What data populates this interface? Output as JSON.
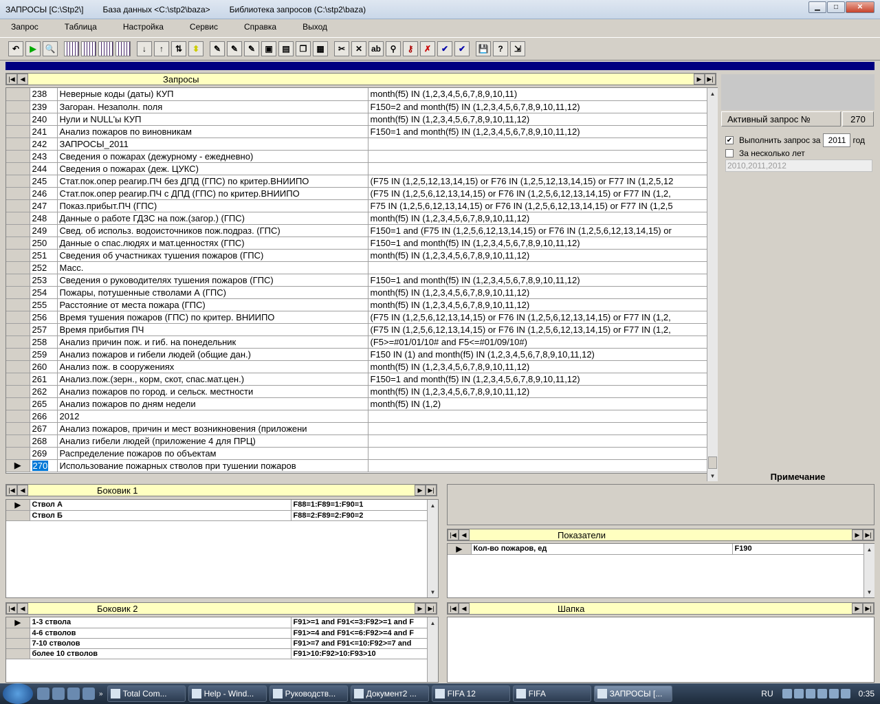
{
  "window": {
    "title": "ЗАПРОСЫ [C:\\Stp2\\]",
    "db": "База данных <C:\\stp2\\baza>",
    "lib": "Библиотека запросов (C:\\stp2\\baza)"
  },
  "menu": [
    "Запрос",
    "Таблица",
    "Настройка",
    "Сервис",
    "Справка",
    "Выход"
  ],
  "main": {
    "title": "Запросы",
    "rows": [
      {
        "n": "238",
        "name": "Неверные коды (даты) КУП",
        "cond": "month(f5) IN (1,2,3,4,5,6,7,8,9,10,11)"
      },
      {
        "n": "239",
        "name": "Загоран. Незаполн. поля",
        "cond": "F150=2 and month(f5) IN (1,2,3,4,5,6,7,8,9,10,11,12)"
      },
      {
        "n": "240",
        "name": "Нули и NULL'ы КУП",
        "cond": "month(f5) IN (1,2,3,4,5,6,7,8,9,10,11,12)"
      },
      {
        "n": "241",
        "name": "Анализ пожаров по виновникам",
        "cond": "F150=1 and month(f5) IN (1,2,3,4,5,6,7,8,9,10,11,12)"
      },
      {
        "n": "242",
        "name": "ЗАПРОСЫ_2011",
        "cond": ""
      },
      {
        "n": "243",
        "name": "Сведения о пожарах (дежурному - ежедневно)",
        "cond": ""
      },
      {
        "n": "244",
        "name": "Сведения о пожарах (деж. ЦУКС)",
        "cond": ""
      },
      {
        "n": "245",
        "name": "Стат.пок.опер реагир.ПЧ без ДПД (ГПС) по критер.ВНИИПО",
        "cond": "(F75 IN (1,2,5,12,13,14,15) or F76 IN (1,2,5,12,13,14,15) or F77 IN (1,2,5,12"
      },
      {
        "n": "246",
        "name": "Стат.пок.опер реагир.ПЧ с ДПД (ГПС) по критер.ВНИИПО",
        "cond": "(F75 IN (1,2,5,6,12,13,14,15) or F76 IN (1,2,5,6,12,13,14,15) or F77 IN (1,2,"
      },
      {
        "n": "247",
        "name": "Показ.прибыт.ПЧ (ГПС)",
        "cond": "F75 IN (1,2,5,6,12,13,14,15) or F76 IN (1,2,5,6,12,13,14,15) or F77 IN (1,2,5"
      },
      {
        "n": "248",
        "name": "Данные о работе ГДЗС на пож.(загор.) (ГПС)",
        "cond": "month(f5) IN (1,2,3,4,5,6,7,8,9,10,11,12)"
      },
      {
        "n": "249",
        "name": "Свед. об использ. водоисточников пож.подраз. (ГПС)",
        "cond": "F150=1 and (F75 IN (1,2,5,6,12,13,14,15) or F76 IN (1,2,5,6,12,13,14,15) or"
      },
      {
        "n": "250",
        "name": "Данные о спас.людях и мат.ценностях (ГПС)",
        "cond": "F150=1 and month(f5) IN (1,2,3,4,5,6,7,8,9,10,11,12)"
      },
      {
        "n": "251",
        "name": "Сведения об участниках тушения пожаров (ГПС)",
        "cond": "month(f5) IN (1,2,3,4,5,6,7,8,9,10,11,12)"
      },
      {
        "n": "252",
        "name": "Масс.",
        "cond": ""
      },
      {
        "n": "253",
        "name": "Сведения о руководителях тушения пожаров (ГПС)",
        "cond": "F150=1 and month(f5) IN (1,2,3,4,5,6,7,8,9,10,11,12)"
      },
      {
        "n": "254",
        "name": "Пожары, потушенные стволами А (ГПС)",
        "cond": "month(f5) IN (1,2,3,4,5,6,7,8,9,10,11,12)"
      },
      {
        "n": "255",
        "name": "Расстояние от места пожара (ГПС)",
        "cond": "month(f5) IN (1,2,3,4,5,6,7,8,9,10,11,12)"
      },
      {
        "n": "256",
        "name": "Время тушения пожаров (ГПС) по критер. ВНИИПО",
        "cond": "(F75 IN (1,2,5,6,12,13,14,15) or F76 IN (1,2,5,6,12,13,14,15) or F77 IN (1,2,"
      },
      {
        "n": "257",
        "name": "Время прибытия ПЧ",
        "cond": "(F75 IN (1,2,5,6,12,13,14,15) or F76 IN (1,2,5,6,12,13,14,15) or F77 IN (1,2,"
      },
      {
        "n": "258",
        "name": "Анализ причин пож. и гиб. на понедельник",
        "cond": "(F5>=#01/01/10# and F5<=#01/09/10#)"
      },
      {
        "n": "259",
        "name": "Анализ пожаров и гибели людей (общие дан.)",
        "cond": "F150 IN (1) and month(f5) IN (1,2,3,4,5,6,7,8,9,10,11,12)"
      },
      {
        "n": "260",
        "name": "Анализ пож. в сооружениях",
        "cond": "month(f5) IN (1,2,3,4,5,6,7,8,9,10,11,12)"
      },
      {
        "n": "261",
        "name": "Анализ.пож.(зерн., корм, скот, спас.мат.цен.)",
        "cond": "F150=1 and month(f5) IN (1,2,3,4,5,6,7,8,9,10,11,12)"
      },
      {
        "n": "262",
        "name": "Анализ пожаров по город. и сельск. местности",
        "cond": "month(f5) IN (1,2,3,4,5,6,7,8,9,10,11,12)"
      },
      {
        "n": "265",
        "name": "Анализ пожаров по дням недели",
        "cond": "month(f5) IN (1,2)"
      },
      {
        "n": "266",
        "name": "2012",
        "cond": ""
      },
      {
        "n": "267",
        "name": "Анализ пожаров, причин и мест возникновения (приложени",
        "cond": ""
      },
      {
        "n": "268",
        "name": "Анализ гибели людей (приложение 4 для ПРЦ)",
        "cond": ""
      },
      {
        "n": "269",
        "name": "Распределение пожаров по объектам",
        "cond": ""
      },
      {
        "n": "270",
        "name": "Использование пожарных стволов при тушении пожаров",
        "cond": "",
        "selected": true
      }
    ]
  },
  "right": {
    "active_label": "Активный запрос №",
    "active_value": "270",
    "run_label": "Выполнить запрос за",
    "run_year": "2011",
    "year_suffix": "год",
    "multi_label": "За несколько лет",
    "multi_value": "2010,2011,2012",
    "note_label": "Примечание"
  },
  "side1": {
    "title": "Боковик 1",
    "rows": [
      {
        "name": "Ствол А",
        "cond": "F88=1:F89=1:F90=1"
      },
      {
        "name": "Ствол Б",
        "cond": "F88=2:F89=2:F90=2"
      }
    ]
  },
  "indicators": {
    "title": "Показатели",
    "rows": [
      {
        "name": "Кол-во пожаров, ед",
        "cond": "F190"
      }
    ]
  },
  "side2": {
    "title": "Боковик 2",
    "rows": [
      {
        "name": "1-3 ствола",
        "cond": "F91>=1 and F91<=3:F92>=1 and F"
      },
      {
        "name": "4-6 стволов",
        "cond": "F91>=4 and F91<=6:F92>=4 and F"
      },
      {
        "name": "7-10 стволов",
        "cond": "F91>=7 and F91<=10:F92>=7 and"
      },
      {
        "name": "более 10 стволов",
        "cond": "F91>10:F92>10:F93>10"
      }
    ]
  },
  "header": {
    "title": "Шапка"
  },
  "taskbar": {
    "tasks": [
      "Total Com...",
      "Help - Wind...",
      "Руководств...",
      "Документ2 ...",
      "FIFA 12",
      "FIFA",
      "ЗАПРОСЫ [..."
    ],
    "lang": "RU",
    "time": "0:35"
  }
}
